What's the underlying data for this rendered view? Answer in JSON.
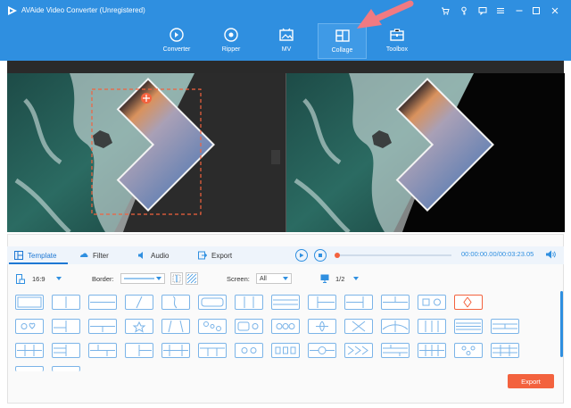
{
  "window": {
    "title": "AVAide Video Converter (Unregistered)",
    "controls": [
      "cart-icon",
      "key-icon",
      "feedback-icon",
      "menu-icon",
      "minimize-icon",
      "maximize-icon",
      "close-icon"
    ]
  },
  "nav": [
    {
      "label": "Converter",
      "icon": "converter-icon",
      "active": false
    },
    {
      "label": "Ripper",
      "icon": "ripper-icon",
      "active": false
    },
    {
      "label": "MV",
      "icon": "mv-icon",
      "active": false
    },
    {
      "label": "Collage",
      "icon": "collage-icon",
      "active": true
    },
    {
      "label": "Toolbox",
      "icon": "toolbox-icon",
      "active": false
    }
  ],
  "tabs": [
    {
      "label": "Template",
      "icon": "template-icon",
      "active": true
    },
    {
      "label": "Filter",
      "icon": "filter-icon",
      "active": false
    },
    {
      "label": "Audio",
      "icon": "audio-icon",
      "active": false
    },
    {
      "label": "Export",
      "icon": "export-icon",
      "active": false
    }
  ],
  "player": {
    "time": "00:00:00.00/00:03:23.05",
    "progress": 0.0
  },
  "options": {
    "aspect": "16:9",
    "border_label": "Border:",
    "screen_label": "Screen:",
    "screen_value": "All",
    "page": "1/2"
  },
  "export_button": "Export",
  "colors": {
    "brand": "#2f8fe0",
    "accent": "#f3623e"
  }
}
